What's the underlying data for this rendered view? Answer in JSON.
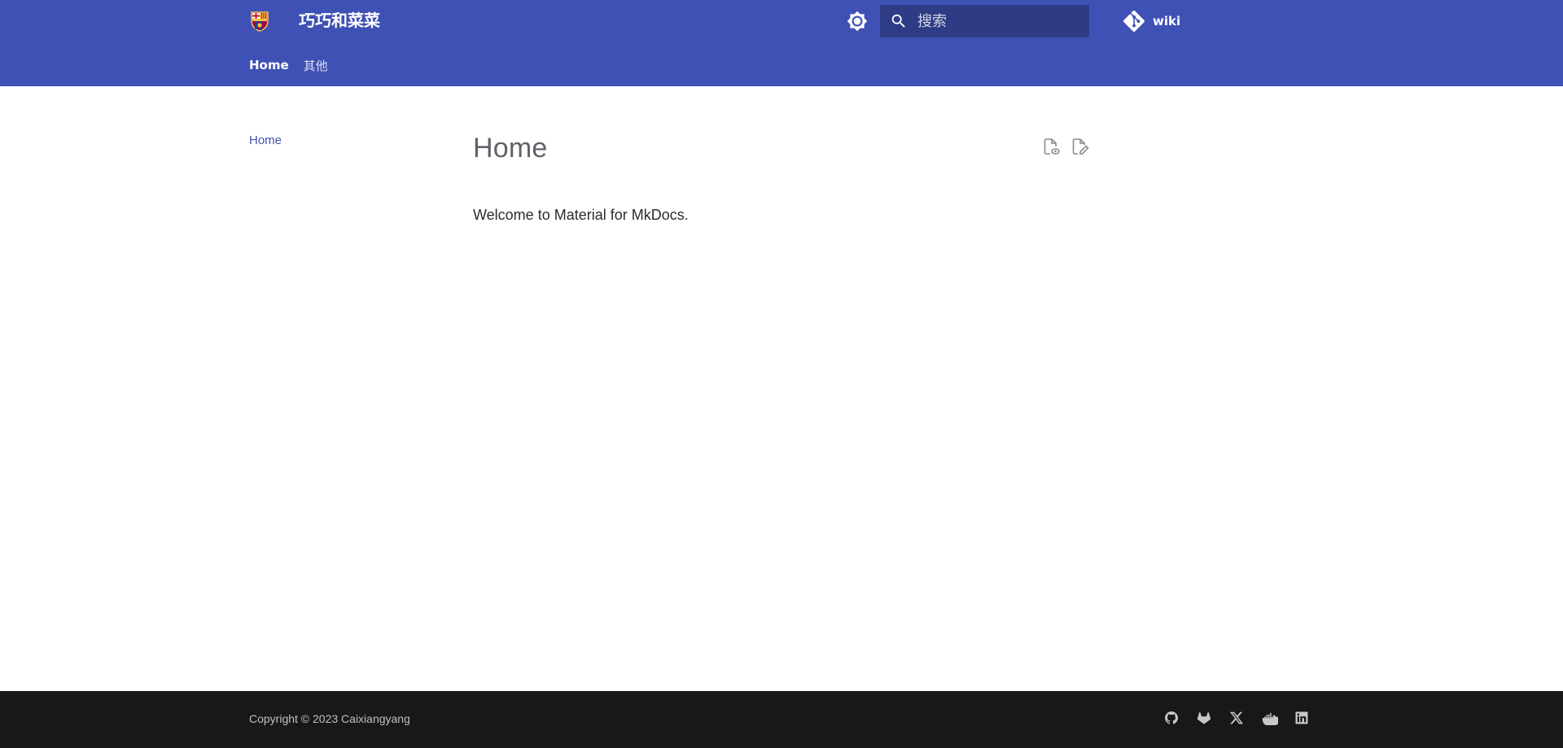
{
  "header": {
    "site_title": "巧巧和菜菜",
    "logo_icon": "fc-barcelona-crest-icon",
    "theme_toggle_icon": "brightness-icon",
    "search": {
      "placeholder": "搜索",
      "value": ""
    },
    "repo": {
      "icon": "git-icon",
      "name": "wiki"
    },
    "tabs": [
      {
        "label": "Home",
        "active": true
      },
      {
        "label": "其他",
        "active": false
      }
    ],
    "background_color": "#3f51b5"
  },
  "sidebar": {
    "items": [
      {
        "label": "Home",
        "active": true
      }
    ]
  },
  "content": {
    "title": "Home",
    "actions": [
      {
        "icon": "view-source-icon"
      },
      {
        "icon": "edit-page-icon"
      }
    ],
    "body": "Welcome to Material for MkDocs."
  },
  "footer": {
    "copyright": "Copyright © 2023 Caixiangyang",
    "social": [
      {
        "icon": "github-icon"
      },
      {
        "icon": "gitlab-icon"
      },
      {
        "icon": "x-twitter-icon"
      },
      {
        "icon": "docker-icon"
      },
      {
        "icon": "linkedin-icon"
      }
    ],
    "background_color": "#181818"
  }
}
